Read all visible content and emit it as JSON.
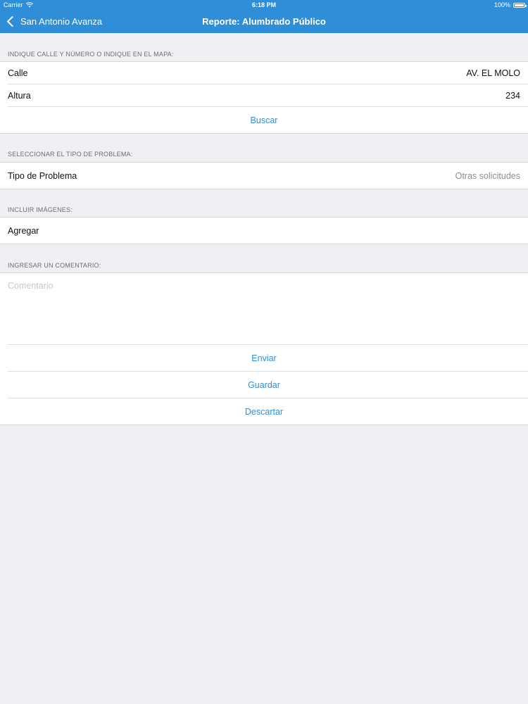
{
  "status": {
    "carrier": "Carrier",
    "time": "6:18 PM",
    "battery": "100%"
  },
  "nav": {
    "back_label": "San Antonio Avanza",
    "title": "Reporte: Alumbrado Público"
  },
  "address": {
    "header": "INDIQUE CALLE Y NÚMERO O INDIQUE EN EL MAPA:",
    "street_label": "Calle",
    "street_value": "AV. EL MOLO",
    "number_label": "Altura",
    "number_value": "234",
    "search_label": "Buscar"
  },
  "problem": {
    "header": "SELECCIONAR EL TIPO DE PROBLEMA:",
    "type_label": "Tipo de Problema",
    "type_value": "Otras solicitudes"
  },
  "images": {
    "header": "INCLUIR IMÁGENES:",
    "add_label": "Agregar"
  },
  "comment": {
    "header": "INGRESAR UN COMENTARIO:",
    "placeholder": "Comentario",
    "value": ""
  },
  "actions": {
    "send_label": "Enviar",
    "save_label": "Guardar",
    "discard_label": "Descartar"
  },
  "colors": {
    "accent": "#2e8fd8",
    "background": "#efeff4"
  }
}
